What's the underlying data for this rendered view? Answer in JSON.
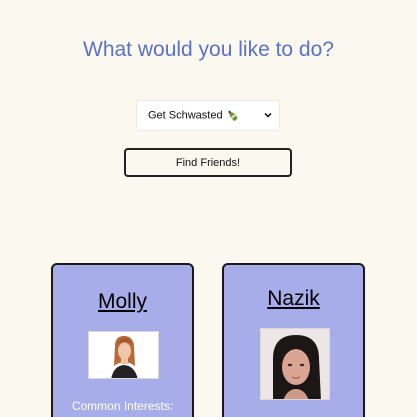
{
  "heading": "What would you like to do?",
  "activity_select": {
    "selected": "Get Schwasted",
    "icon": "bottle-icon"
  },
  "find_button": {
    "label": "Find Friends!"
  },
  "colors": {
    "background": "#fbf8ef",
    "heading": "#5b72c8",
    "card": "#a6ade8"
  },
  "cards": [
    {
      "name": "Molly",
      "interests_label": "Common Interests:"
    },
    {
      "name": "Nazik"
    }
  ]
}
